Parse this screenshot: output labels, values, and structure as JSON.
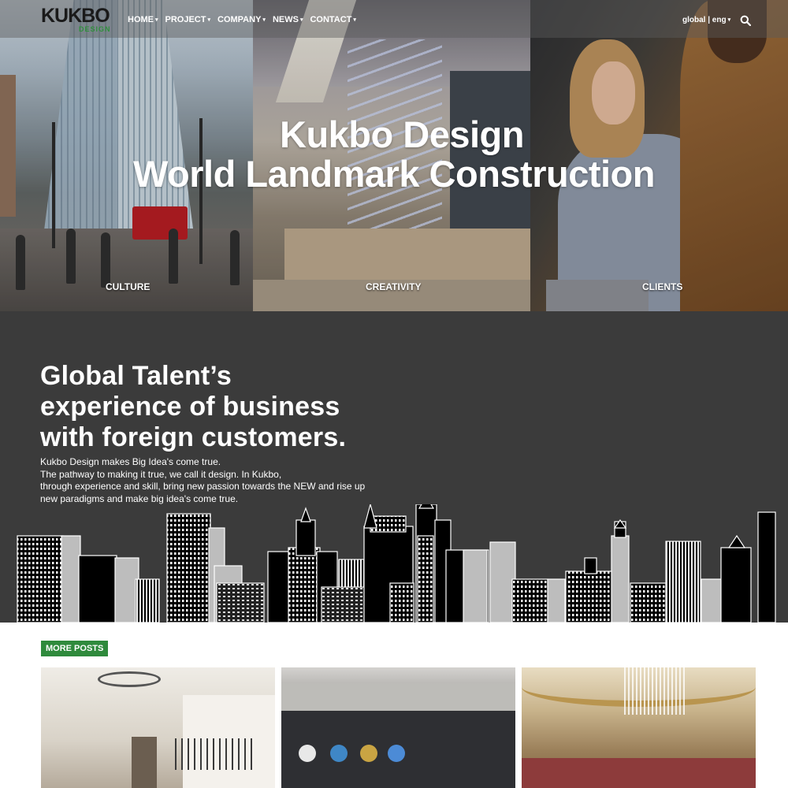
{
  "brand": {
    "name": "KUKBO",
    "sub": "DESIGN"
  },
  "nav": {
    "items": [
      {
        "label": "HOME"
      },
      {
        "label": "PROJECT"
      },
      {
        "label": "COMPANY"
      },
      {
        "label": "NEWS"
      },
      {
        "label": "CONTACT"
      }
    ],
    "caret": "▾",
    "language": "global | eng",
    "search_icon": "search-icon"
  },
  "hero": {
    "title_line1": "Kukbo Design",
    "title_line2": "World Landmark Construction",
    "panels": [
      {
        "label": "CULTURE"
      },
      {
        "label": "CREATIVITY"
      },
      {
        "label": "CLIENTS"
      }
    ]
  },
  "talent": {
    "heading": [
      "Global Talent’s",
      "experience of business",
      "with foreign customers."
    ],
    "body": [
      "Kukbo Design makes Big Idea's come true.",
      "The pathway to making it true, we call it design. In Kukbo,",
      "through experience and skill, bring new passion towards the NEW and rise up",
      "new paradigms and make big idea's come true."
    ]
  },
  "more_posts": {
    "label": "MORE POSTS"
  },
  "colors": {
    "accent_green": "#2f8a3c",
    "dark_section": "#3b3b3b",
    "white": "#ffffff"
  }
}
